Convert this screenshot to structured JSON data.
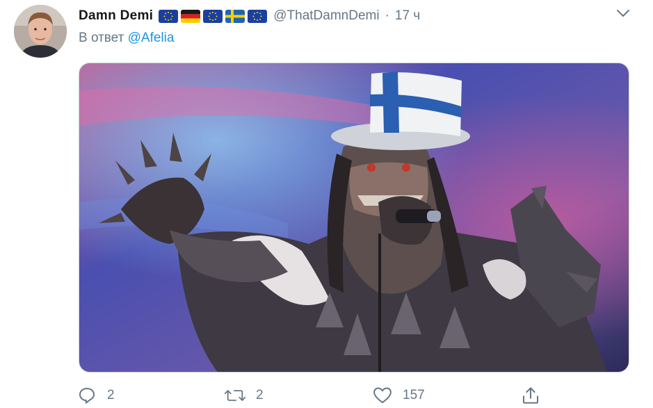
{
  "tweet": {
    "display_name": "Damn Demi",
    "flags": [
      "eu-flag",
      "germany-flag",
      "eu-flag",
      "sweden-flag",
      "eu-flag"
    ],
    "handle": "@ThatDamnDemi",
    "separator": "·",
    "time": "17 ч",
    "reply_prefix": "В ответ",
    "reply_mention": "@Afelia",
    "media_description": "",
    "actions": {
      "reply_count": "2",
      "retweet_count": "2",
      "like_count": "157"
    }
  },
  "colors": {
    "text": "#14171a",
    "secondary": "#657786",
    "link": "#1b95e0",
    "border": "#ccd6dd"
  },
  "icons": [
    "avatar",
    "chevron-down-icon",
    "reply-icon",
    "retweet-icon",
    "like-icon",
    "share-icon"
  ]
}
